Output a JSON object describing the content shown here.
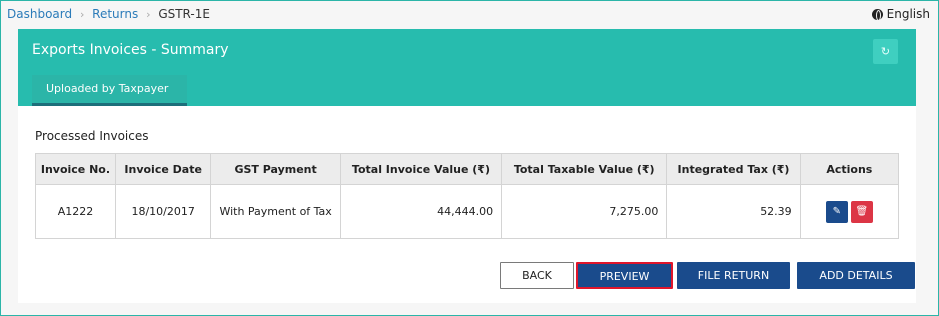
{
  "breadcrumb": {
    "items": [
      "Dashboard",
      "Returns"
    ],
    "current": "GSTR-1E",
    "separator": "›"
  },
  "language": {
    "label": "English",
    "icon": "globe-icon"
  },
  "panel": {
    "title": "Exports Invoices - Summary",
    "refresh_icon": "refresh-icon",
    "tab_label": "Uploaded by Taxpayer"
  },
  "section_title": "Processed Invoices",
  "table": {
    "headers": [
      "Invoice No.",
      "Invoice Date",
      "GST Payment",
      "Total Invoice Value (₹)",
      "Total Taxable Value (₹)",
      "Integrated Tax (₹)",
      "Actions"
    ],
    "rows": [
      {
        "invoice_no": "A1222",
        "invoice_date": "18/10/2017",
        "gst_payment": "With Payment of Tax",
        "total_invoice_value": "44,444.00",
        "total_taxable_value": "7,275.00",
        "integrated_tax": "52.39",
        "edit_icon": "✎",
        "delete_icon": "🗑"
      }
    ]
  },
  "buttons": {
    "back": "BACK",
    "preview": "PREVIEW",
    "file_return": "FILE RETURN",
    "add_details": "ADD DETAILS"
  },
  "colors": {
    "header_teal": "#27bcae",
    "primary_blue": "#1a4b8c",
    "danger_red": "#dc3545",
    "highlight_border": "#e0162b",
    "link_blue": "#2b7bb9"
  }
}
